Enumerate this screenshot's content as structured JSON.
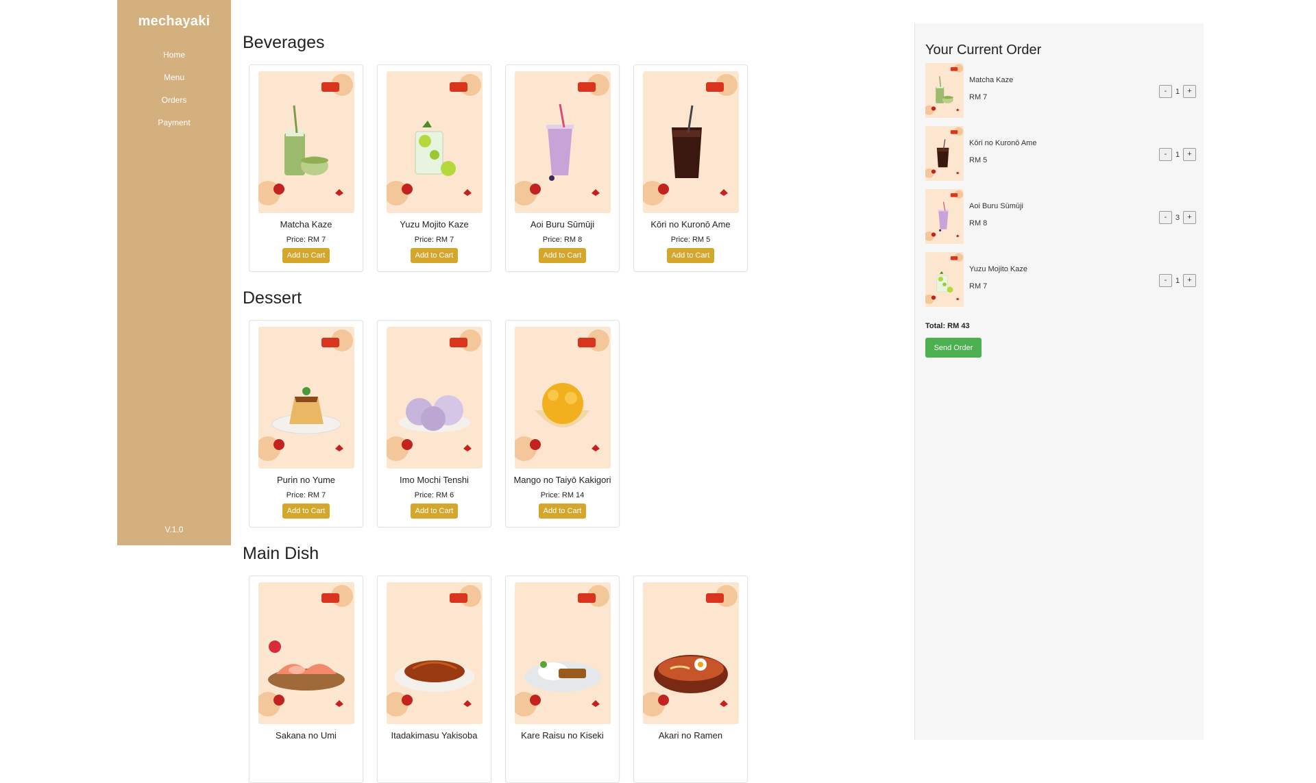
{
  "app": {
    "brand": "mechayaki",
    "version": "V.1.0"
  },
  "nav": [
    {
      "label": "Home"
    },
    {
      "label": "Menu"
    },
    {
      "label": "Orders"
    },
    {
      "label": "Payment"
    }
  ],
  "colors": {
    "sidebar": "#d4b07e",
    "add_button": "#d4a72c",
    "send_button": "#4caf50",
    "card_bg": "#fde6cf"
  },
  "sections": [
    {
      "title": "Beverages",
      "items": [
        {
          "name": "Matcha Kaze",
          "price": "Price: RM 7",
          "button": "Add to Cart",
          "food": "matcha"
        },
        {
          "name": "Yuzu Mojito Kaze",
          "price": "Price: RM 7",
          "button": "Add to Cart",
          "food": "mojito"
        },
        {
          "name": "Aoi Buru Sūmūji",
          "price": "Price: RM 8",
          "button": "Add to Cart",
          "food": "smoothie"
        },
        {
          "name": "Kōri no Kuronō Ame",
          "price": "Price: RM 5",
          "button": "Add to Cart",
          "food": "cola"
        }
      ]
    },
    {
      "title": "Dessert",
      "items": [
        {
          "name": "Purin no Yume",
          "price": "Price: RM 7",
          "button": "Add to Cart",
          "food": "pudding"
        },
        {
          "name": "Imo Mochi Tenshi",
          "price": "Price: RM 6",
          "button": "Add to Cart",
          "food": "mochi"
        },
        {
          "name": "Mango no Taiyō Kakigori",
          "price": "Price: RM 14",
          "button": "Add to Cart",
          "food": "kakigori"
        }
      ]
    },
    {
      "title": "Main Dish",
      "items": [
        {
          "name": "Sakana no Umi",
          "price": "",
          "button": "",
          "food": "sashimi"
        },
        {
          "name": "Itadakimasu Yakisoba",
          "price": "",
          "button": "",
          "food": "yakisoba"
        },
        {
          "name": "Kare Raisu no Kiseki",
          "price": "",
          "button": "",
          "food": "curry"
        },
        {
          "name": "Akari no Ramen",
          "price": "",
          "button": "",
          "food": "ramen"
        }
      ]
    }
  ],
  "order": {
    "title": "Your Current Order",
    "items": [
      {
        "name": "Matcha Kaze",
        "price": "RM 7",
        "qty": "1",
        "food": "matcha"
      },
      {
        "name": "Kōri no Kuronō Ame",
        "price": "RM 5",
        "qty": "1",
        "food": "cola"
      },
      {
        "name": "Aoi Buru Sūmūji",
        "price": "RM 8",
        "qty": "3",
        "food": "smoothie"
      },
      {
        "name": "Yuzu Mojito Kaze",
        "price": "RM 7",
        "qty": "1",
        "food": "mojito"
      }
    ],
    "minus": "-",
    "plus": "+",
    "total": "Total: RM 43",
    "send": "Send Order"
  }
}
